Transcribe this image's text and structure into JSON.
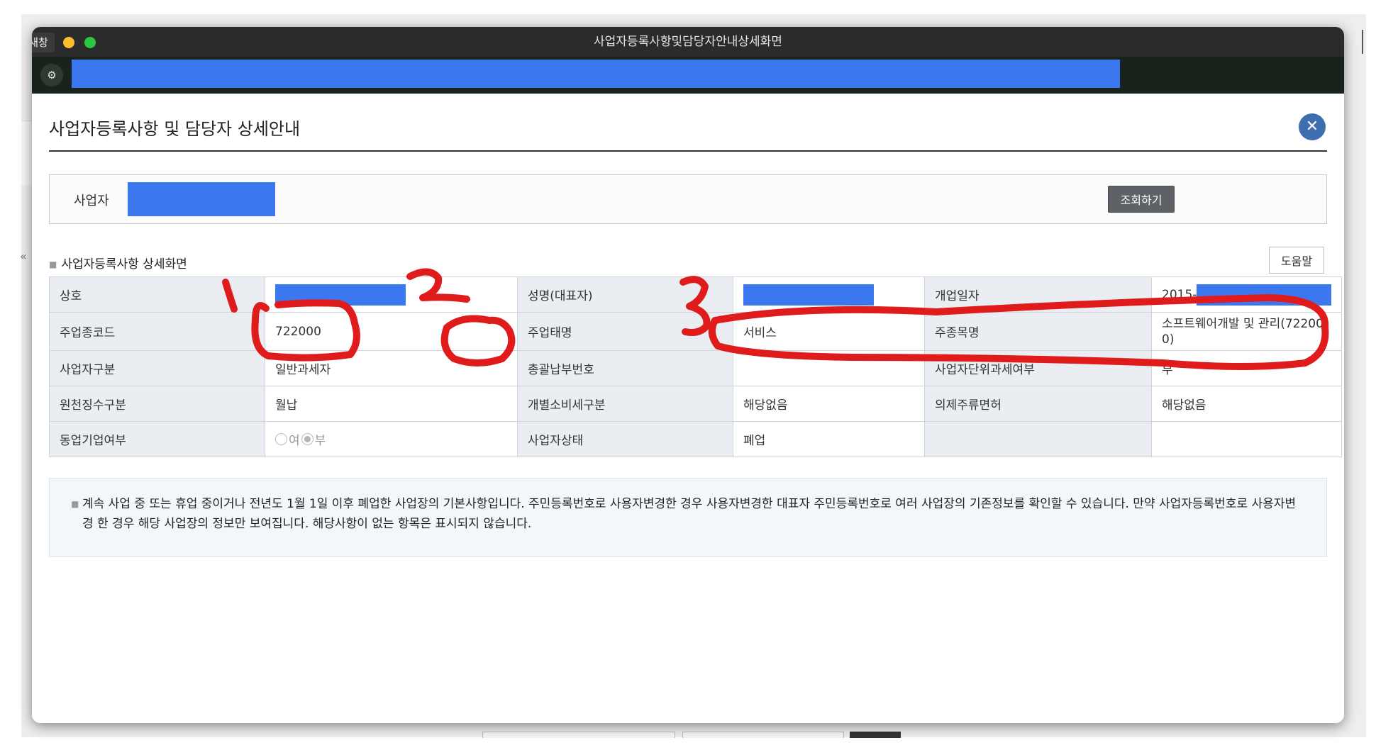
{
  "window": {
    "title": "사업자등록사항및담당자안내상세화면",
    "new_window_badge": "새창"
  },
  "page": {
    "title": "사업자등록사항 및 담당자 상세안내",
    "close_symbol": "✕"
  },
  "search": {
    "label": "사업자",
    "button_label": "조회하기"
  },
  "section": {
    "title": "사업자등록사항 상세화면",
    "help_label": "도움말"
  },
  "table": {
    "rows": [
      [
        {
          "label": "상호",
          "value": "",
          "redacted": true
        },
        {
          "label": "성명(대표자)",
          "value": "",
          "redacted": true
        },
        {
          "label": "개업일자",
          "value": "2015-",
          "redacted": true
        }
      ],
      [
        {
          "label": "주업종코드",
          "value": "722000"
        },
        {
          "label": "주업태명",
          "value": "서비스"
        },
        {
          "label": "주종목명",
          "value": "소프트웨어개발 및 관리(722000)"
        }
      ],
      [
        {
          "label": "사업자구분",
          "value": "일반과세자"
        },
        {
          "label": "총괄납부번호",
          "value": ""
        },
        {
          "label": "사업자단위과세여부",
          "value": "부"
        }
      ],
      [
        {
          "label": "원천징수구분",
          "value": "월납"
        },
        {
          "label": "개별소비세구분",
          "value": "해당없음"
        },
        {
          "label": "의제주류면허",
          "value": "해당없음"
        }
      ],
      [
        {
          "label": "동업기업여부",
          "value": "",
          "radio": {
            "options": [
              "여",
              "부"
            ],
            "selected": "부"
          }
        },
        {
          "label": "사업자상태",
          "value": "폐업"
        },
        {
          "label": "",
          "value": ""
        }
      ]
    ]
  },
  "notice": {
    "text": "계속 사업 중 또는 휴업 중이거나 전년도 1월 1일 이후 폐업한 사업장의 기본사항입니다. 주민등록번호로 사용자변경한 경우 사용자변경한 대표자 주민등록번호로 여러 사업장의 기존정보를 확인할 수 있습니다. 만약 사업자등록번호로 사용자변경 한 경우 해당 사업장의 정보만 보여집니다. 해당사항이 없는 항목은 표시되지 않습니다."
  },
  "colors": {
    "redaction": "#3b78f0",
    "annotation": "#e01b1b",
    "close_button": "#3d6fb0",
    "label_cell_bg": "#eaedf1",
    "titlebar": "#2b2b2b"
  },
  "annotations": [
    "1",
    "2",
    "3"
  ]
}
